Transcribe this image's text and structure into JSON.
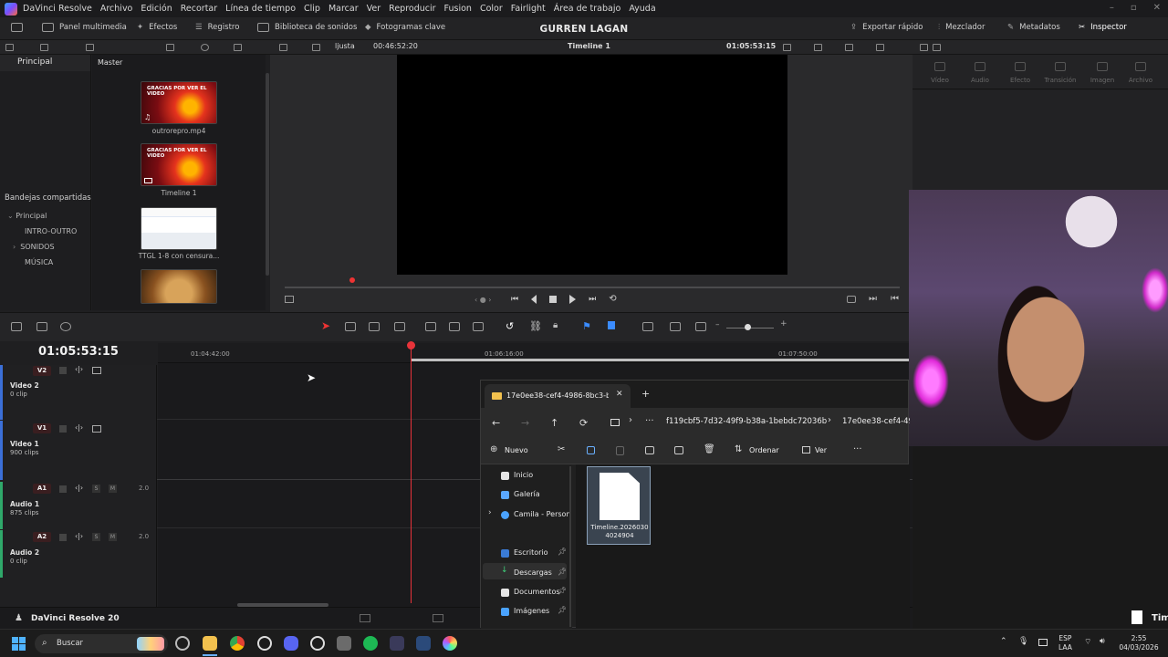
{
  "menubar": {
    "app_name": "DaVinci Resolve",
    "items": [
      "Archivo",
      "Edición",
      "Recortar",
      "Línea de tiempo",
      "Clip",
      "Marcar",
      "Ver",
      "Reproducir",
      "Fusion",
      "Color",
      "Fairlight",
      "Área de trabajo",
      "Ayuda"
    ]
  },
  "toolbar": {
    "media_pool": "Panel multimedia",
    "effects": "Efectos",
    "log": "Registro",
    "sound_library": "Biblioteca de sonidos",
    "keyframes": "Fotogramas clave",
    "project_title": "GURREN LAGAN",
    "quick_export": "Exportar rápido",
    "mixer": "Mezclador",
    "metadata": "Metadatos",
    "inspector": "Inspector"
  },
  "viewer_bar": {
    "fit": "ljusta",
    "source_tc": "00:46:52:20",
    "timeline_name": "Timeline 1",
    "record_tc": "01:05:53:15"
  },
  "media": {
    "main_bin": "Principal",
    "pool_header": "Master",
    "clips": [
      {
        "name": "outrorepro.mp4",
        "overlay": "GRACIAS POR VER EL VIDEO"
      },
      {
        "name": "Timeline 1",
        "overlay": "GRACIAS POR VER EL VIDEO"
      },
      {
        "name": "TTGL 1-8 con censura...",
        "overlay": ""
      }
    ],
    "shared_bins_label": "Bandejas compartidas",
    "bins": [
      "Principal",
      "INTRO-OUTRO",
      "SONIDOS",
      "MÚSICA"
    ]
  },
  "inspector_tabs": [
    "Vídeo",
    "Audio",
    "Efecto",
    "Transición",
    "Imagen",
    "Archivo"
  ],
  "timeline": {
    "timecode": "01:05:53:15",
    "ruler": [
      "01:04:42:00",
      "01:06:16:00",
      "01:07:50:00"
    ],
    "tracks": [
      {
        "badge": "V2",
        "name": "Video 2",
        "clips": "0 clip"
      },
      {
        "badge": "V1",
        "name": "Video 1",
        "clips": "900 clips"
      },
      {
        "badge": "A1",
        "name": "Audio 1",
        "clips": "875 clips",
        "level": "2.0"
      },
      {
        "badge": "A2",
        "name": "Audio 2",
        "clips": "0 clip",
        "level": "2.0"
      }
    ],
    "solo": "S",
    "mute": "M"
  },
  "status": {
    "app": "DaVinci Resolve 20"
  },
  "explorer": {
    "tab_title": "17e0ee38-cef4-4986-8bc3-b8",
    "breadcrumb_1": "f119cbf5-7d32-49f9-b38a-1bebdc72036b",
    "breadcrumb_2": "17e0ee38-cef4-49",
    "new_label": "Nuevo",
    "sort_label": "Ordenar",
    "view_label": "Ver",
    "sidebar": [
      "Inicio",
      "Galería",
      "Camila - Person",
      "Escritorio",
      "Descargas",
      "Documentos",
      "Imágenes"
    ],
    "file_name_1": "Timeline.2026030",
    "file_name_2": "4024904",
    "peek_label": "Tim"
  },
  "taskbar": {
    "search_placeholder": "Buscar",
    "lang_1": "ESP",
    "lang_2": "LAA",
    "time": "2:55",
    "date": "04/03/2026"
  },
  "colors": {
    "accent_red": "#e8333a",
    "video_accent": "#3b6fd8",
    "audio_accent": "#2fa86a",
    "folder": "#f2c14e"
  }
}
